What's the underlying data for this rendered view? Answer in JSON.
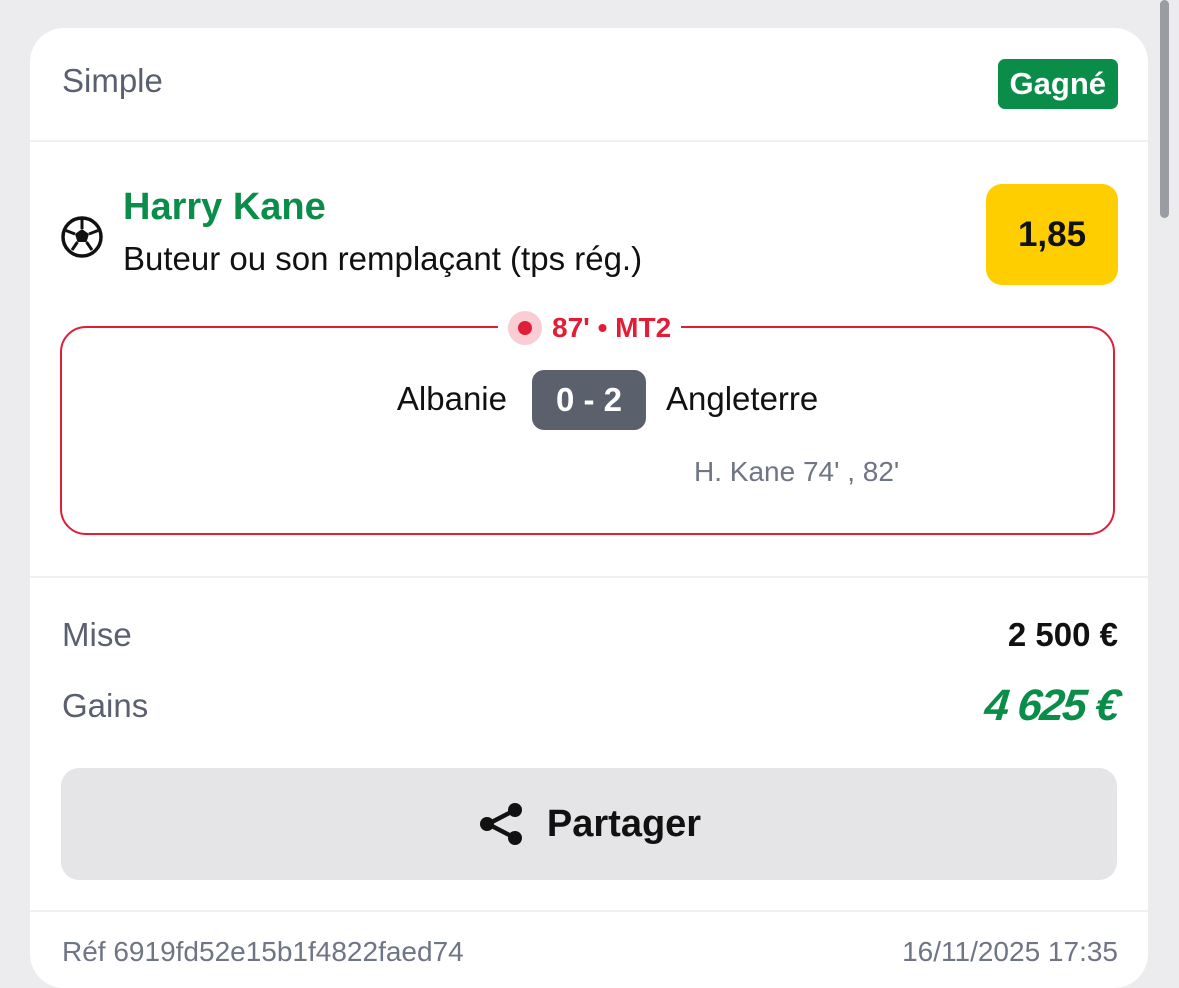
{
  "bet": {
    "type": "Simple",
    "status": "Gagné"
  },
  "selection": {
    "player": "Harry Kane",
    "market": "Buteur ou son remplaçant (tps rég.)",
    "odds": "1,85",
    "sport_icon": "soccer-ball-icon"
  },
  "match": {
    "live_time": "87' • MT2",
    "home_team": "Albanie",
    "score": "0 - 2",
    "away_team": "Angleterre",
    "scorers": "H. Kane 74' , 82'"
  },
  "summary": {
    "stake_label": "Mise",
    "stake_value": "2 500 €",
    "gains_label": "Gains",
    "gains_value": "4 625 €"
  },
  "share": {
    "label": "Partager",
    "icon": "share-icon"
  },
  "footer": {
    "ref": "Réf 6919fd52e15b1f4822faed74",
    "date": "16/11/2025 17:35"
  },
  "colors": {
    "win_green": "#0b8d4a",
    "odds_yellow": "#ffce00",
    "live_red": "#e21d36",
    "score_gray": "#5a606c"
  }
}
